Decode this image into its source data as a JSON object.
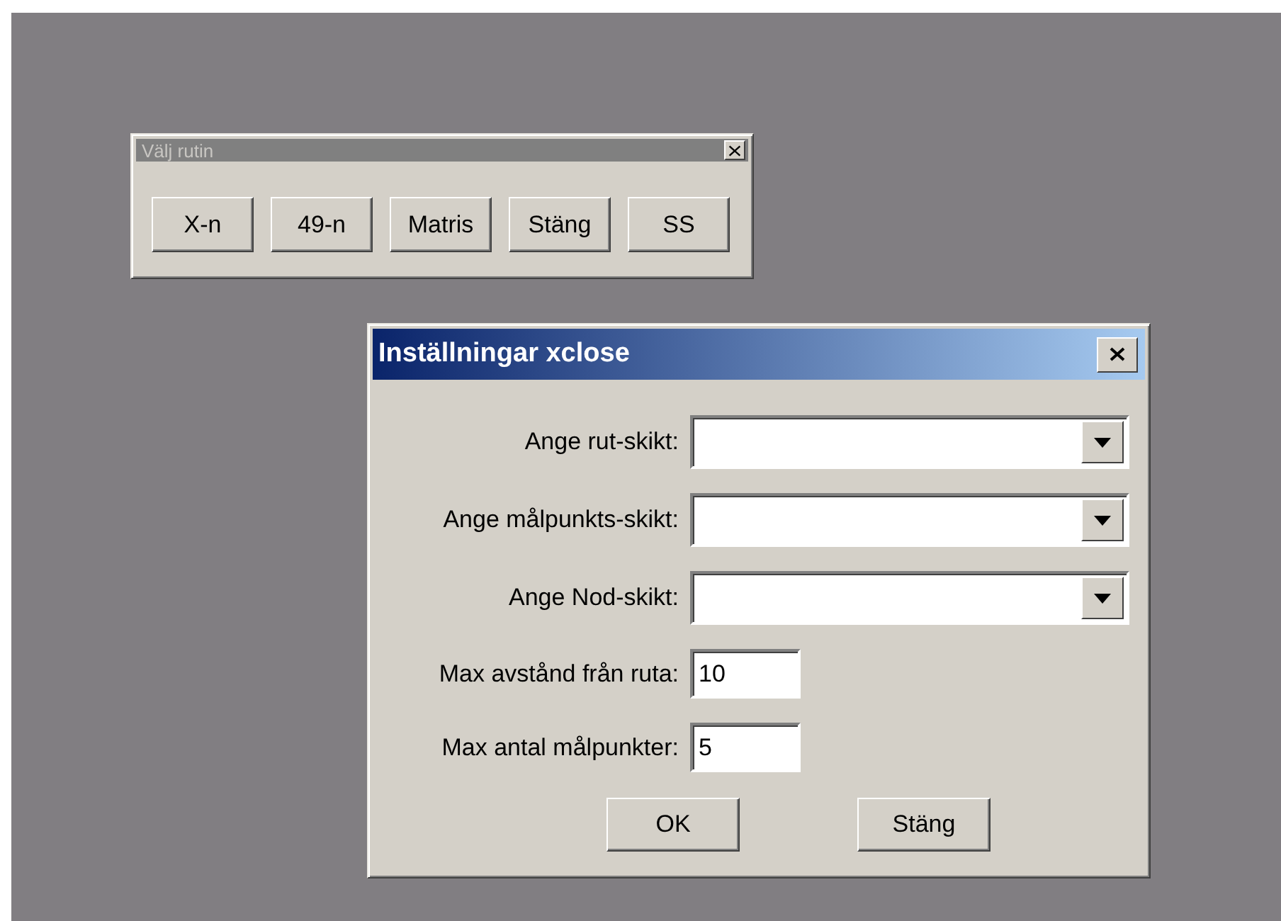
{
  "windows": [
    {
      "kind": "toolbox",
      "title": "Välj rutin",
      "active": false,
      "buttons": [
        "X-n",
        "49-n",
        "Matris",
        "Stäng",
        "SS"
      ]
    },
    {
      "kind": "dialog",
      "title": "Inställningar xclose",
      "active": true,
      "fields": [
        {
          "kind": "combo",
          "label": "Ange rut-skikt:"
        },
        {
          "kind": "combo",
          "label": "Ange målpunkts-skikt:"
        },
        {
          "kind": "combo",
          "label": "Ange Nod-skikt:"
        },
        {
          "kind": "text",
          "label": "Max avstånd från ruta:",
          "value": "10"
        },
        {
          "kind": "text",
          "label": "Max antal målpunkter:",
          "value": "5"
        }
      ],
      "buttons": [
        "OK",
        "Stäng"
      ]
    }
  ]
}
